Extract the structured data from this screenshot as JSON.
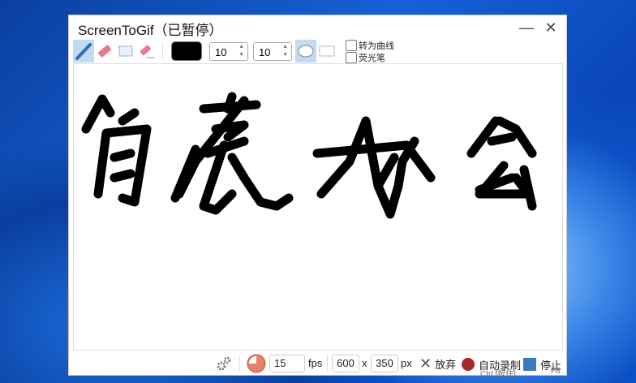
{
  "window": {
    "title": "ScreenToGif（已暂停）",
    "minimize_icon": "minimize-icon",
    "close_icon": "close-icon"
  },
  "toolbar": {
    "tools": [
      "pen-icon",
      "eraser-icon",
      "select-rectangle-icon",
      "clear-eraser-icon"
    ],
    "selected_tool": "pen",
    "color": "#000000",
    "width_value": "10",
    "height_value": "10",
    "tip_shapes": [
      "ellipse",
      "rectangle"
    ],
    "selected_tip": "ellipse",
    "fit_to_curve_label": "转为曲线",
    "highlighter_label": "荧光笔"
  },
  "footer": {
    "settings_icon": "gear-icon",
    "fps_value": "15",
    "fps_label": "fps",
    "width_value": "600",
    "x_label": "x",
    "height_value": "350",
    "px_label": "px",
    "discard_label": "放弃",
    "record_label": "自动录制",
    "record_shortcut": "Ctrl [按住]",
    "stop_label": "停止",
    "stop_shortcut": "F8",
    "record_color": "#a52a2a",
    "stop_color": "#3a7abf"
  }
}
